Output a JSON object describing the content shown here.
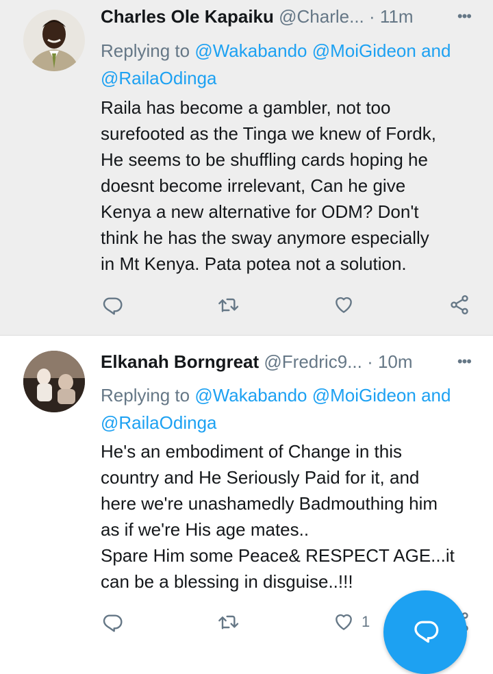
{
  "tweets": [
    {
      "author_name": "Charles Ole Kapaiku",
      "handle": "@Charle...",
      "separator": "·",
      "time": "11m",
      "replying_prefix": "Replying to",
      "mentions_line1": "@Wakabando @MoiGideon",
      "and_word": "and",
      "mentions_line2": "@RailaOdinga",
      "body_lines": [
        "Raila has become a gambler, not too",
        "surefooted as the Tinga we knew of Fordk,",
        "He seems to be shuffling cards hoping he",
        "doesnt become irrelevant, Can he give",
        "Kenya a new alternative for ODM? Don't",
        "think he has the sway anymore especially",
        "in Mt Kenya. Pata potea not a solution."
      ],
      "like_count": ""
    },
    {
      "author_name": "Elkanah Borngreat",
      "handle": "@Fredric9...",
      "separator": "·",
      "time": "10m",
      "replying_prefix": "Replying to",
      "mentions_line1": "@Wakabando @MoiGideon",
      "and_word": "and",
      "mentions_line2": "@RailaOdinga",
      "body_lines": [
        "He's an embodiment of Change in this",
        "country and He Seriously Paid for it, and",
        "here we're unashamedly Badmouthing him",
        "as if we're His age mates..",
        "Spare Him some Peace& RESPECT AGE...it",
        "can be a blessing in disguise..!!!"
      ],
      "like_count": "1"
    }
  ],
  "icons": {
    "reply": "reply-icon",
    "retweet": "retweet-icon",
    "like": "heart-icon",
    "share": "share-icon",
    "more": "more-icon",
    "compose": "compose-icon"
  },
  "colors": {
    "link": "#1da1f2",
    "secondary_text": "#657786",
    "primary_text": "#14171a",
    "highlight_background": "#eeeeee",
    "fab": "#1da1f2"
  }
}
